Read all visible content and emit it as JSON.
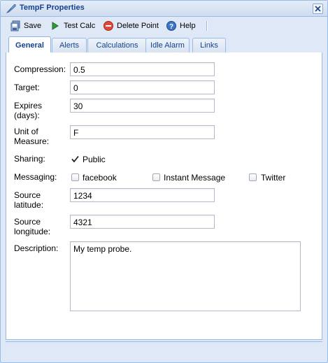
{
  "window": {
    "title": "TempF Properties",
    "close_icon": "close-icon"
  },
  "toolbar": {
    "save_label": "Save",
    "test_calc_label": "Test Calc",
    "delete_point_label": "Delete Point",
    "help_label": "Help"
  },
  "tabs": [
    {
      "label": "General",
      "active": true
    },
    {
      "label": "Alerts",
      "active": false
    },
    {
      "label": "Calculations",
      "active": false
    },
    {
      "label": "Idle Alarm",
      "active": false
    },
    {
      "label": "Links",
      "active": false
    }
  ],
  "form": {
    "compression": {
      "label": "Compression:",
      "value": "0.5"
    },
    "target": {
      "label": "Target:",
      "value": "0"
    },
    "expires": {
      "label_line1": "Expires",
      "label_line2": "(days):",
      "value": "30"
    },
    "unit": {
      "label_line1": "Unit of",
      "label_line2": "Measure:",
      "value": "F"
    },
    "sharing": {
      "label": "Sharing:",
      "option": "Public",
      "checked": true
    },
    "messaging": {
      "label": "Messaging:",
      "options": [
        {
          "label": "facebook",
          "checked": false
        },
        {
          "label": "Instant Message",
          "checked": false
        },
        {
          "label": "Twitter",
          "checked": false
        }
      ]
    },
    "latitude": {
      "label_line1": "Source",
      "label_line2": "latitude:",
      "value": "1234"
    },
    "longitude": {
      "label_line1": "Source",
      "label_line2": "longitude:",
      "value": "4321"
    },
    "description": {
      "label": "Description:",
      "value": "My temp probe."
    }
  },
  "colors": {
    "accent": "#15428b",
    "border": "#99bbe8",
    "frame": "#dfe8f6"
  }
}
